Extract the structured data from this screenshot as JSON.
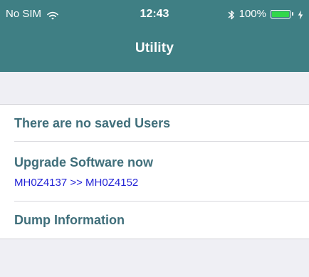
{
  "status_bar": {
    "carrier": "No SIM",
    "time": "12:43",
    "battery_percent": "100%",
    "battery_level": 1.0,
    "icons": [
      "wifi-icon",
      "bluetooth-icon",
      "battery-icon",
      "charging-icon"
    ]
  },
  "nav_bar": {
    "title": "Utility",
    "color": "#3f7f84"
  },
  "list": {
    "items": [
      {
        "label": "There are no saved Users"
      },
      {
        "label": "Upgrade Software now",
        "sublabel": "MH0Z4137 >> MH0Z4152"
      },
      {
        "label": "Dump Information"
      }
    ]
  },
  "colors": {
    "item_text": "#3f6e7a",
    "version_text": "#2424d6",
    "background": "#efeff4",
    "battery_fill": "#32d74b"
  }
}
